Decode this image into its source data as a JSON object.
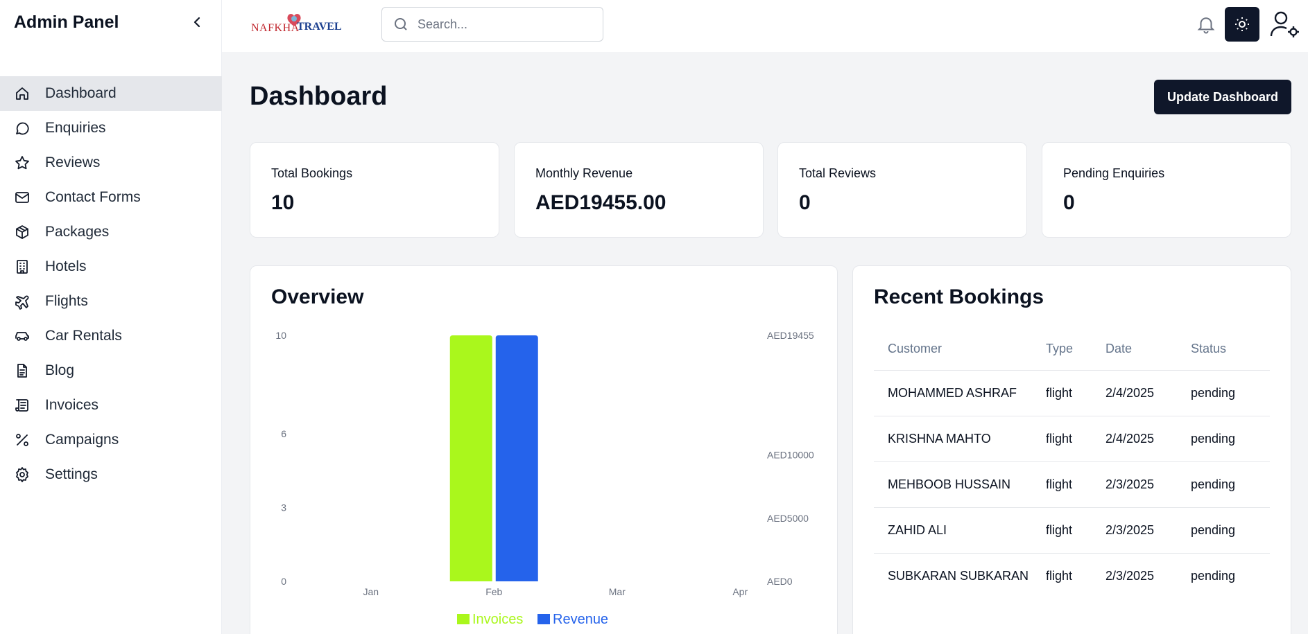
{
  "sidebar": {
    "title": "Admin Panel",
    "items": [
      {
        "label": "Dashboard",
        "icon": "home-icon",
        "active": true
      },
      {
        "label": "Enquiries",
        "icon": "chat-bubble-icon"
      },
      {
        "label": "Reviews",
        "icon": "star-icon"
      },
      {
        "label": "Contact Forms",
        "icon": "mail-icon"
      },
      {
        "label": "Packages",
        "icon": "package-icon"
      },
      {
        "label": "Hotels",
        "icon": "building-icon"
      },
      {
        "label": "Flights",
        "icon": "plane-icon"
      },
      {
        "label": "Car Rentals",
        "icon": "car-icon"
      },
      {
        "label": "Blog",
        "icon": "document-icon"
      },
      {
        "label": "Invoices",
        "icon": "scroll-icon"
      },
      {
        "label": "Campaigns",
        "icon": "percent-icon"
      },
      {
        "label": "Settings",
        "icon": "gear-icon"
      }
    ]
  },
  "header": {
    "logo_left": "NAFKHA",
    "logo_right": "TRAVEL",
    "search_placeholder": "Search..."
  },
  "main": {
    "title": "Dashboard",
    "update_button": "Update Dashboard",
    "stats": [
      {
        "label": "Total Bookings",
        "value": "10"
      },
      {
        "label": "Monthly Revenue",
        "value": "AED19455.00"
      },
      {
        "label": "Total Reviews",
        "value": "0"
      },
      {
        "label": "Pending Enquiries",
        "value": "0"
      }
    ]
  },
  "overview": {
    "title": "Overview"
  },
  "chart_data": {
    "type": "bar",
    "categories": [
      "Jan",
      "Feb",
      "Mar",
      "Apr"
    ],
    "series": [
      {
        "name": "Invoices",
        "axis": "left",
        "color": "#aaf71c",
        "values": [
          0,
          10,
          0,
          0
        ]
      },
      {
        "name": "Revenue",
        "axis": "right",
        "color": "#2563eb",
        "values": [
          0,
          19455,
          0,
          0
        ]
      }
    ],
    "left_axis": {
      "ticks": [
        {
          "value": 0,
          "label": "0"
        },
        {
          "value": 3,
          "label": "3"
        },
        {
          "value": 6,
          "label": "6"
        },
        {
          "value": 10,
          "label": "10"
        }
      ],
      "range": [
        0,
        10
      ]
    },
    "right_axis": {
      "ticks": [
        {
          "value": 0,
          "label": "AED0"
        },
        {
          "value": 5000,
          "label": "AED5000"
        },
        {
          "value": 10000,
          "label": "AED10000"
        },
        {
          "value": 19455,
          "label": "AED19455"
        }
      ],
      "range": [
        0,
        19455
      ]
    },
    "grid": false,
    "legend": "bottom-center"
  },
  "recent": {
    "title": "Recent Bookings",
    "columns": [
      "Customer",
      "Type",
      "Date",
      "Status"
    ],
    "rows": [
      [
        "MOHAMMED ASHRAF",
        "flight",
        "2/4/2025",
        "pending"
      ],
      [
        "KRISHNA MAHTO",
        "flight",
        "2/4/2025",
        "pending"
      ],
      [
        "MEHBOOB HUSSAIN",
        "flight",
        "2/3/2025",
        "pending"
      ],
      [
        "ZAHID ALI",
        "flight",
        "2/3/2025",
        "pending"
      ],
      [
        "SUBKARAN SUBKARAN",
        "flight",
        "2/3/2025",
        "pending"
      ]
    ]
  }
}
